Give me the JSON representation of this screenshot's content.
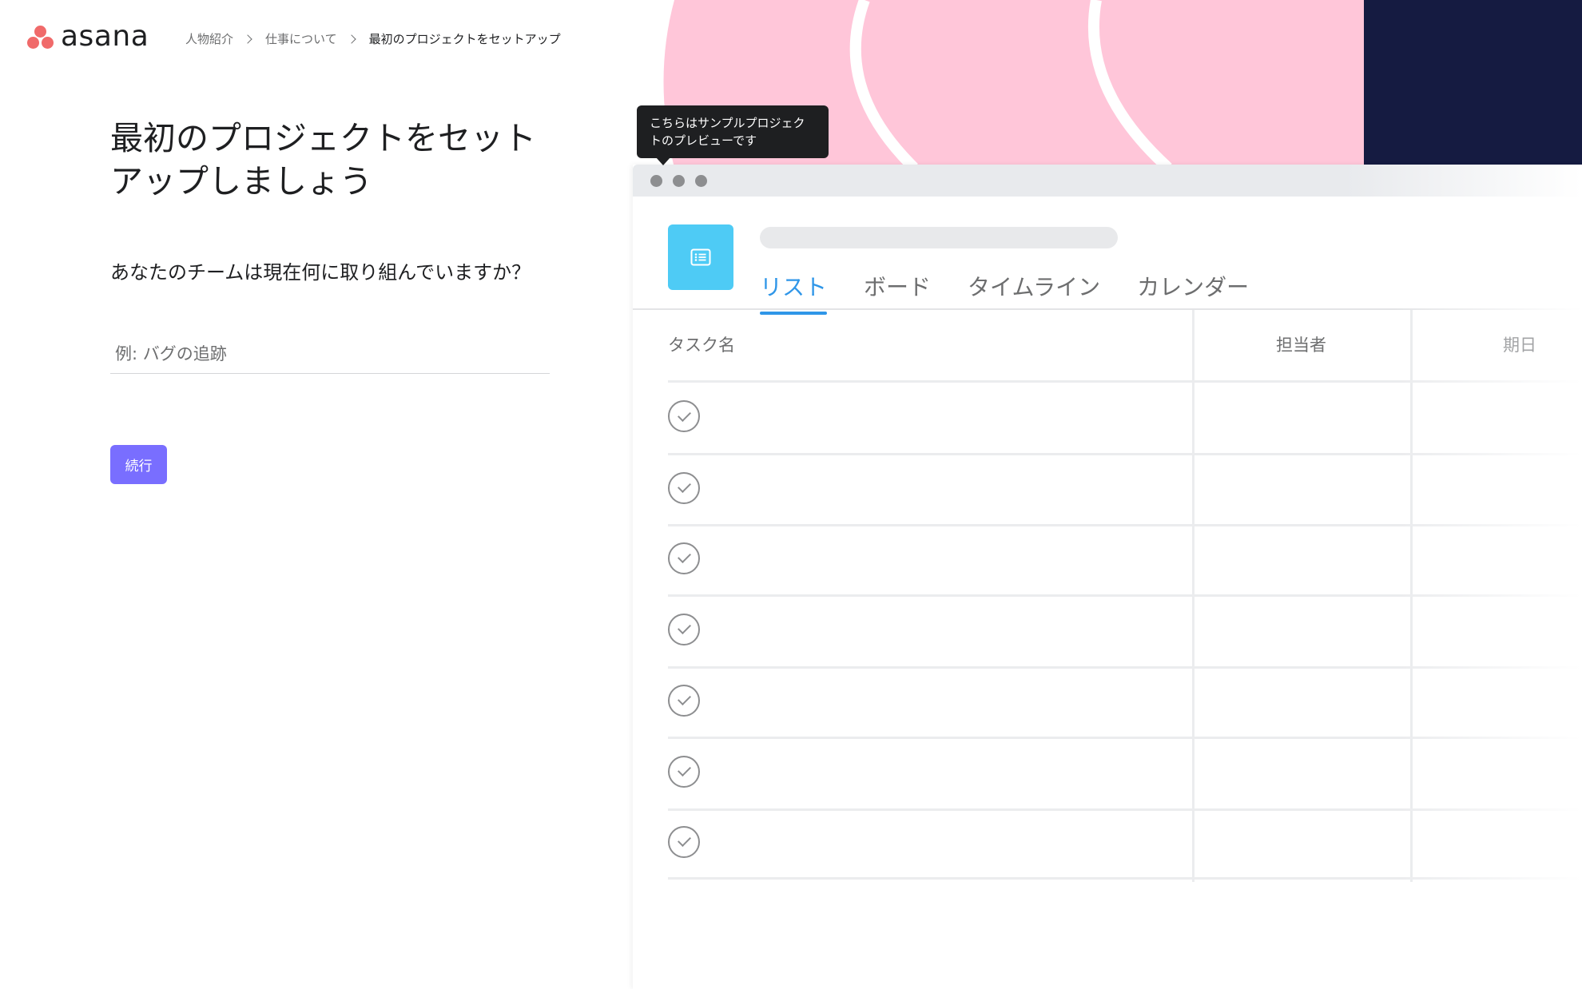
{
  "brand": {
    "name": "asana"
  },
  "breadcrumb": [
    "人物紹介",
    "仕事について",
    "最初のプロジェクトをセットアップ"
  ],
  "form": {
    "title": "最初のプロジェクトをセットアップしましょう",
    "question": "あなたのチームは現在何に取り組んでいますか？",
    "input_placeholder": "例: バグの追跡",
    "input_value": "",
    "continue_label": "続行"
  },
  "preview": {
    "tooltip": "こちらはサンプルプロジェクトのプレビューです",
    "tabs": [
      {
        "label": "リスト",
        "active": true
      },
      {
        "label": "ボード",
        "active": false
      },
      {
        "label": "タイムライン",
        "active": false
      },
      {
        "label": "カレンダー",
        "active": false
      }
    ],
    "columns": [
      "タスク名",
      "担当者",
      "期日"
    ],
    "task_rows": 7
  },
  "colors": {
    "accent_purple": "#796eff",
    "tab_active_blue": "#2f96e8",
    "project_icon_cyan": "#4ecbf5",
    "logo_coral": "#f06a6a",
    "deco_pink": "#ffc6d9",
    "deco_navy": "#151b41"
  }
}
